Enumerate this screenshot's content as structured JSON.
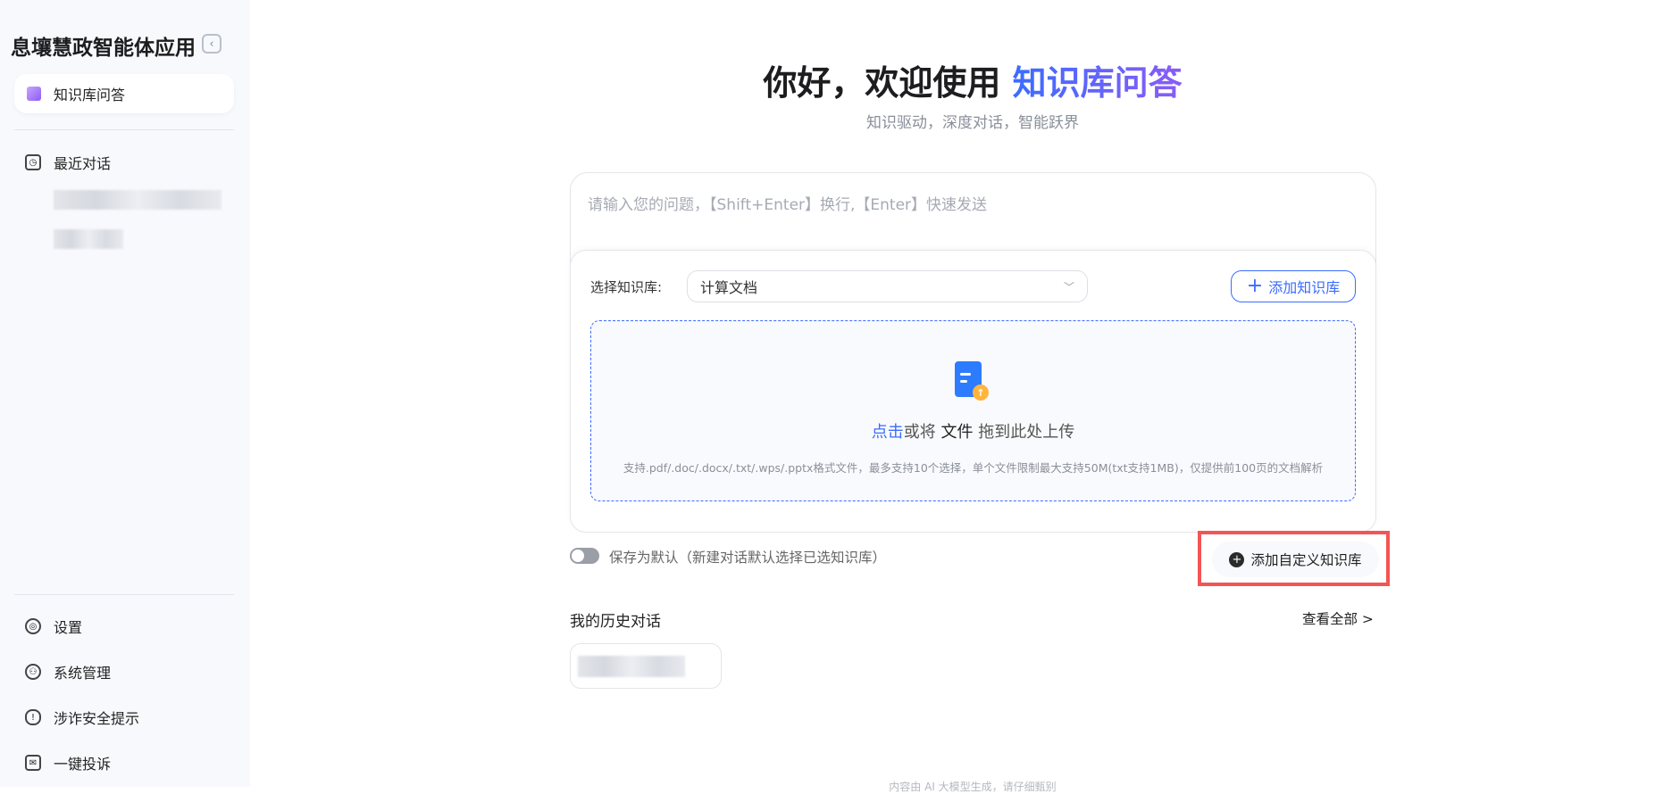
{
  "sidebar": {
    "app_title": "息壤慧政智能体应用",
    "active_item": "知识库问答",
    "recent_label": "最近对话",
    "bottom_items": [
      "设置",
      "系统管理",
      "涉诈安全提示",
      "一键投诉"
    ]
  },
  "main": {
    "heading_prefix": "你好，欢迎使用 ",
    "heading_highlight": "知识库问答",
    "subtitle": "知识驱动，深度对话，智能跃界",
    "input_placeholder": "请输入您的问题，【Shift+Enter】换行,【Enter】快速发送",
    "kb_select_label": "选择知识库:",
    "kb_select_value": "计算文档",
    "add_kb_label": "添加知识库",
    "upload": {
      "click": "点击",
      "or": "或将 ",
      "file": "文件",
      "drag": " 拖到此处上传",
      "hint": "支持.pdf/.doc/.docx/.txt/.wps/.pptx格式文件，最多支持10个选择，单个文件限制最大支持50M(txt支持1MB)，仅提供前100页的文档解析"
    },
    "save_default_label": "保存为默认（新建对话默认选择已选知识库）",
    "save_default_on": false,
    "add_custom_kb_label": "添加自定义知识库",
    "history_title": "我的历史对话",
    "view_all_label": "查看全部 >",
    "footer": "内容由 AI 大模型生成，请仔细甄别"
  }
}
